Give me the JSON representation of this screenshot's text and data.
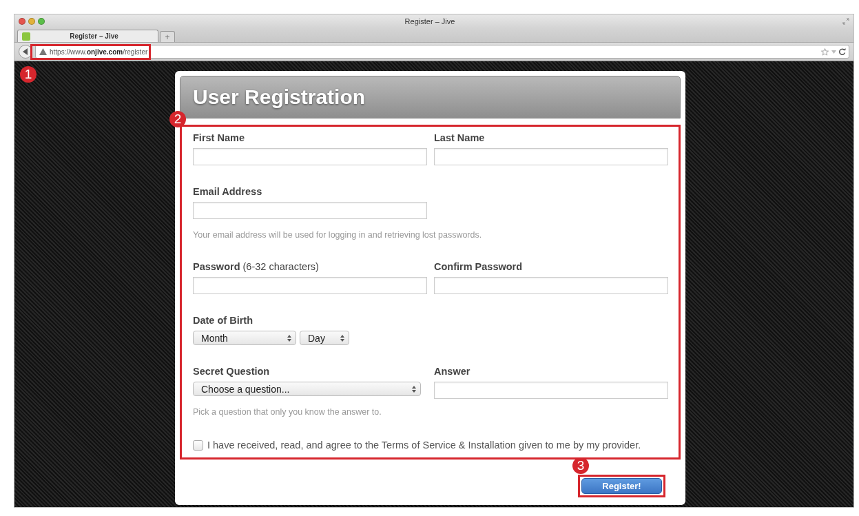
{
  "browser": {
    "window_title": "Register – Jive",
    "tabs": [
      {
        "label": "Register – Jive",
        "selected": true
      }
    ],
    "new_tab": "+",
    "url": {
      "scheme": "https://www.",
      "domain": "onjive.com",
      "path": "/register"
    }
  },
  "annotations": [
    "1",
    "2",
    "3"
  ],
  "form": {
    "title": "User Registration",
    "rows": [
      {
        "fields": [
          {
            "kind": "text",
            "label": "First Name"
          },
          {
            "kind": "text",
            "label": "Last Name"
          }
        ]
      },
      {
        "fields": [
          {
            "kind": "text",
            "label": "Email Address",
            "hint": "Your email address will be used for logging in and retrieving lost passwords."
          }
        ]
      },
      {
        "fields": [
          {
            "kind": "text",
            "label": "Password",
            "note": "(6-32 characters)"
          },
          {
            "kind": "text",
            "label": "Confirm Password"
          }
        ]
      },
      {
        "fields": [
          {
            "kind": "selects",
            "label": "Date of Birth",
            "options": [
              "Month",
              "Day"
            ]
          }
        ]
      },
      {
        "fields": [
          {
            "kind": "select",
            "label": "Secret Question",
            "value": "Choose a question...",
            "hint": "Pick a question that only you know the answer to."
          },
          {
            "kind": "text",
            "label": "Answer"
          }
        ]
      }
    ],
    "agreement": {
      "checked": false,
      "text": "I have received, read, and agree to the Terms of Service & Installation given to me by my provider."
    },
    "submit": "Register!"
  }
}
